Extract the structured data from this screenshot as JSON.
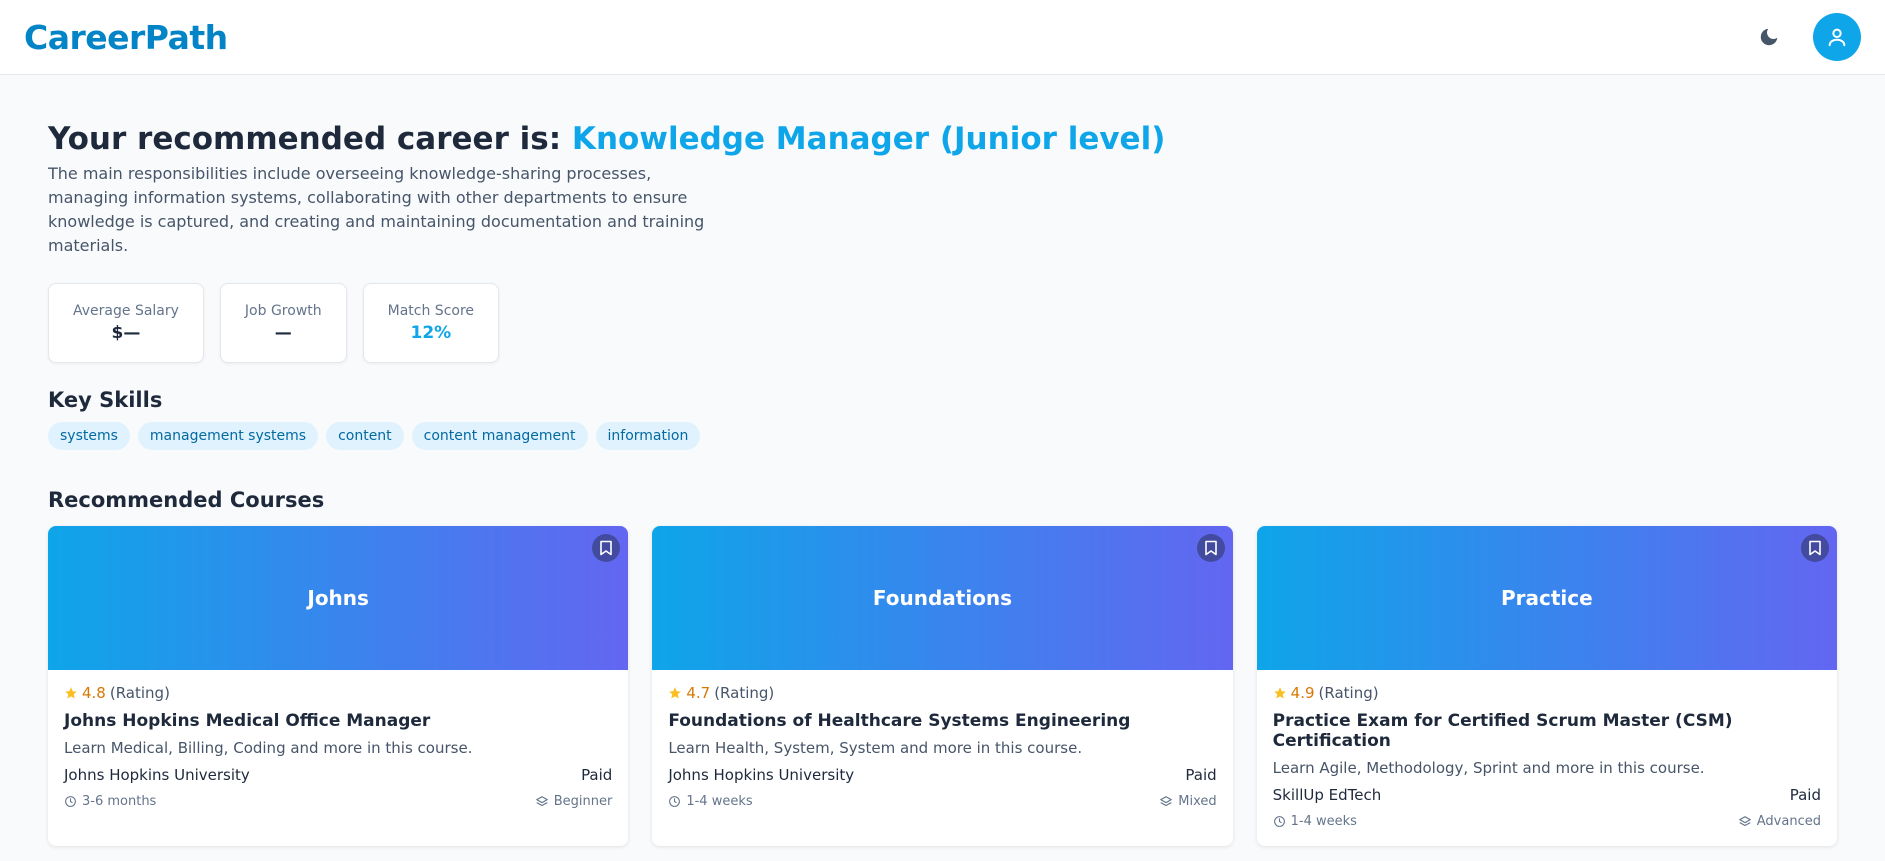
{
  "app": {
    "logo": "CareerPath"
  },
  "header": {
    "theme_icon": "moon-icon",
    "profile_icon": "user-icon"
  },
  "career": {
    "prefix": "Your recommended career is:",
    "title": "Knowledge Manager (Junior level)",
    "description": "The main responsibilities include overseeing knowledge-sharing processes, managing information systems, collaborating with other departments to ensure knowledge is captured, and creating and maintaining documentation and training materials."
  },
  "stats": [
    {
      "label": "Average Salary",
      "value": "$—"
    },
    {
      "label": "Job Growth",
      "value": "—"
    },
    {
      "label": "Match Score",
      "value": "12%"
    }
  ],
  "skills": {
    "title": "Key Skills",
    "items": [
      "systems",
      "management systems",
      "content",
      "content management",
      "information"
    ]
  },
  "courses": {
    "title": "Recommended Courses",
    "rating_suffix": "(Rating)",
    "items": [
      {
        "banner": "Johns",
        "rating": "4.8",
        "title": "Johns Hopkins Medical Office Manager",
        "description": "Learn Medical, Billing, Coding and more in this course.",
        "provider": "Johns Hopkins University",
        "price": "Paid",
        "duration": "3-6 months",
        "level": "Beginner"
      },
      {
        "banner": "Foundations",
        "rating": "4.7",
        "title": "Foundations of Healthcare Systems Engineering",
        "description": "Learn Health, System, System and more in this course.",
        "provider": "Johns Hopkins University",
        "price": "Paid",
        "duration": "1-4 weeks",
        "level": "Mixed"
      },
      {
        "banner": "Practice",
        "rating": "4.9",
        "title": "Practice Exam for Certified Scrum Master (CSM) Certification",
        "description": "Learn Agile, Methodology, Sprint and more in this course.",
        "provider": "SkillUp EdTech",
        "price": "Paid",
        "duration": "1-4 weeks",
        "level": "Advanced"
      }
    ]
  },
  "colors": {
    "brand": "#0284c7",
    "accent": "#0ea5e9",
    "gradient_start": "#0ea5e9",
    "gradient_end": "#6366f1",
    "star": "#fbbf24"
  }
}
